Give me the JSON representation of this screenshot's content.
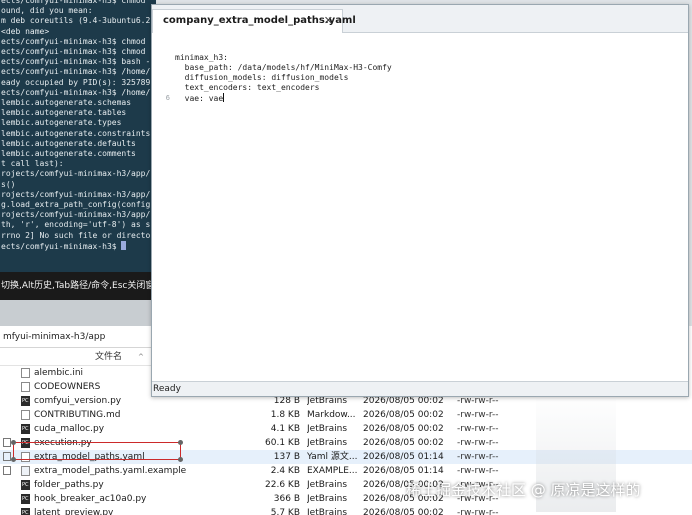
{
  "terminal": {
    "lines": [
      "ects/comfyui-minimax-h3$ chmod",
      "ound, did you mean:",
      "m deb coreutils (9.4-3ubuntu6.2",
      " <deb name>",
      "ects/comfyui-minimax-h3$ chmod",
      "ects/comfyui-minimax-h3$ chmod",
      "ects/comfyui-minimax-h3$ bash -",
      "ects/comfyui-minimax-h3$ /home/",
      "eady occupied by PID(s): 325789",
      "ects/comfyui-minimax-h3$ /home/",
      "lembic.autogenerate.schemas",
      "lembic.autogenerate.tables",
      "lembic.autogenerate.types",
      "lembic.autogenerate.constraints",
      "lembic.autogenerate.defaults",
      "lembic.autogenerate.comments",
      "t call last):",
      "rojects/comfyui-minimax-h3/app/",
      "s()",
      "rojects/comfyui-minimax-h3/app/",
      "g.load_extra_path_config(config",
      "rojects/comfyui-minimax-h3/app/",
      "th, 'r', encoding='utf-8') as s",
      "",
      "rrno 2] No such file or directo",
      "ects/comfyui-minimax-h3$"
    ],
    "hint": "切换,Alt历史,Tab路径/命令,Esc关闭窗"
  },
  "editor": {
    "tab_label": "company_extra_model_paths.yaml",
    "close_glyph": "✕",
    "status": "Ready",
    "lines": [
      {
        "no": "",
        "text": ""
      },
      {
        "no": "",
        "text": "minimax_h3:"
      },
      {
        "no": "",
        "text": "  base_path: /data/models/hf/MiniMax-H3-Comfy"
      },
      {
        "no": "",
        "text": "  diffusion_models: diffusion_models"
      },
      {
        "no": "",
        "text": "  text_encoders: text_encoders"
      },
      {
        "no": "6",
        "text": "  vae: vae"
      }
    ]
  },
  "explorer": {
    "address": "mfyui-minimax-h3/app",
    "column_name": "文件名",
    "sort_glyph": "^",
    "files": [
      {
        "name": "alembic.ini",
        "size": "",
        "type": "",
        "date": "",
        "perm": "",
        "icon": "file"
      },
      {
        "name": "CODEOWNERS",
        "size": "",
        "type": "",
        "date": "",
        "perm": "",
        "icon": "file"
      },
      {
        "name": "comfyui_version.py",
        "size": "128 B",
        "type": "JetBrains",
        "date": "2026/08/05 00:02",
        "perm": "-rw-rw-r--",
        "icon": "py"
      },
      {
        "name": "CONTRIBUTING.md",
        "size": "1.8 KB",
        "type": "Markdow...",
        "date": "2026/08/05 00:02",
        "perm": "-rw-rw-r--",
        "icon": "file"
      },
      {
        "name": "cuda_malloc.py",
        "size": "4.1 KB",
        "type": "JetBrains",
        "date": "2026/08/05 00:02",
        "perm": "-rw-rw-r--",
        "icon": "py"
      },
      {
        "name": "execution.py",
        "size": "60.1 KB",
        "type": "JetBrains",
        "date": "2026/08/05 00:02",
        "perm": "-rw-rw-r--",
        "icon": "py"
      },
      {
        "name": "extra_model_paths.yaml",
        "size": "137 B",
        "type": "Yaml 源文...",
        "date": "2026/08/05 01:14",
        "perm": "-rw-rw-r--",
        "icon": "file"
      },
      {
        "name": "extra_model_paths.yaml.example",
        "size": "2.4 KB",
        "type": "EXAMPLE...",
        "date": "2026/08/05 01:14",
        "perm": "-rw-rw-r--",
        "icon": "ex"
      },
      {
        "name": "folder_paths.py",
        "size": "22.6 KB",
        "type": "JetBrains",
        "date": "2026/08/05 00:02",
        "perm": "-rw-rw-r--",
        "icon": "py"
      },
      {
        "name": "hook_breaker_ac10a0.py",
        "size": "366 B",
        "type": "JetBrains",
        "date": "2026/08/05 00:02",
        "perm": "-rw-rw-r--",
        "icon": "py"
      },
      {
        "name": "latent_preview.py",
        "size": "5.7 KB",
        "type": "JetBrains",
        "date": "2026/08/05 00:02",
        "perm": "-rw-rw-r--",
        "icon": "py"
      }
    ]
  },
  "watermark": "稀土掘金技术社区 @ 原凉是这样的"
}
